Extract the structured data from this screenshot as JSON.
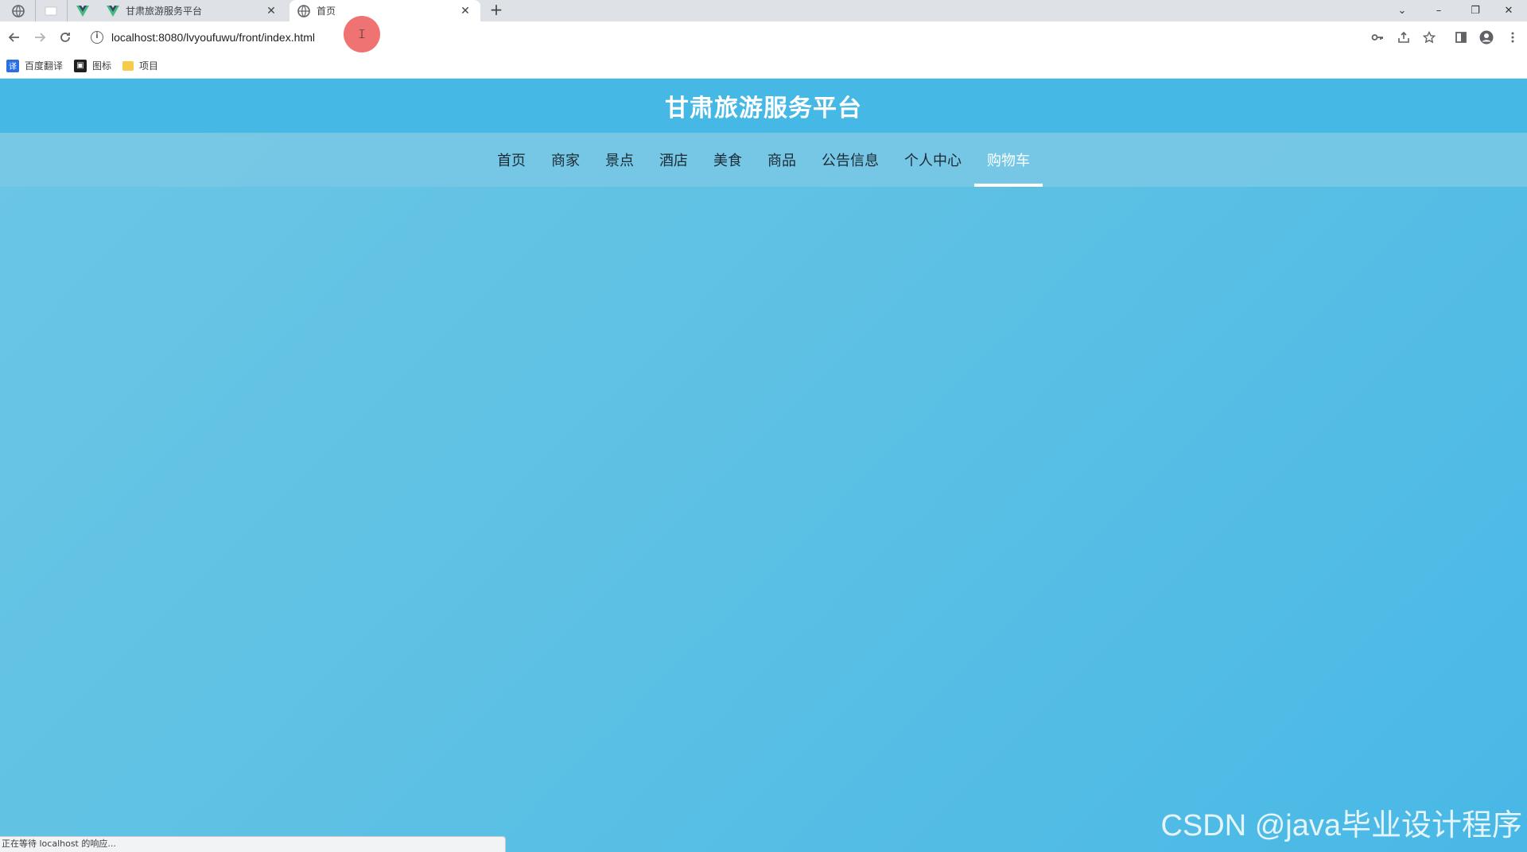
{
  "browser": {
    "tabs": [
      {
        "title": "甘肃旅游服务平台",
        "close": "✕"
      },
      {
        "title": "首页",
        "close": "✕"
      }
    ],
    "new_tab": "+",
    "window_controls": {
      "list": "⌄",
      "minimize": "–",
      "restore": "❐",
      "close": "✕"
    },
    "url": "localhost:8080/lvyoufuwu/front/index.html",
    "bookmarks": [
      {
        "label": "百度翻译",
        "icon": "baidu-translate-icon"
      },
      {
        "label": "图标",
        "icon": "image-icon"
      },
      {
        "label": "项目",
        "icon": "folder-icon"
      }
    ],
    "status_text": "正在等待 localhost 的响应..."
  },
  "site": {
    "title": "甘肃旅游服务平台",
    "nav": [
      {
        "label": "首页"
      },
      {
        "label": "商家"
      },
      {
        "label": "景点"
      },
      {
        "label": "酒店"
      },
      {
        "label": "美食"
      },
      {
        "label": "商品"
      },
      {
        "label": "公告信息"
      },
      {
        "label": "个人中心"
      },
      {
        "label": "购物车",
        "active": true
      }
    ]
  },
  "watermark": "CSDN @java毕业设计程序",
  "colors": {
    "header": "#45b8e6",
    "nav": "#78c8e4",
    "page": "#5ec1e4"
  }
}
